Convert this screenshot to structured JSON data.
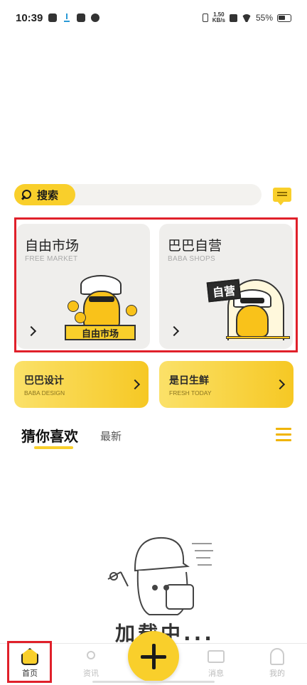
{
  "status_bar": {
    "time": "10:39",
    "speed_value": "1.50",
    "speed_unit": "KB/s",
    "battery": "55%"
  },
  "search": {
    "label": "搜索",
    "placeholder": ""
  },
  "cards": [
    {
      "title": "自由市场",
      "subtitle": "FREE MARKET",
      "sign": "自由市场"
    },
    {
      "title": "巴巴自营",
      "subtitle": "BABA SHOPS",
      "sign": "自营"
    }
  ],
  "small_cards": [
    {
      "title": "巴巴设计",
      "subtitle": "BABA DESIGN"
    },
    {
      "title": "是日生鲜",
      "subtitle": "FRESH TODAY"
    }
  ],
  "tabs": {
    "active": "猜你喜欢",
    "other": "最新"
  },
  "loading": {
    "text": "加载中..."
  },
  "bottom_nav": [
    {
      "label": "首页",
      "icon": "home-icon",
      "active": true
    },
    {
      "label": "资讯",
      "icon": "radio-icon",
      "active": false
    },
    {
      "label": "",
      "icon": "plus-icon",
      "active": false
    },
    {
      "label": "消息",
      "icon": "message-icon",
      "active": false
    },
    {
      "label": "我的",
      "icon": "profile-icon",
      "active": false
    }
  ],
  "colors": {
    "accent": "#f9cf2b",
    "highlight": "#e0202a"
  }
}
